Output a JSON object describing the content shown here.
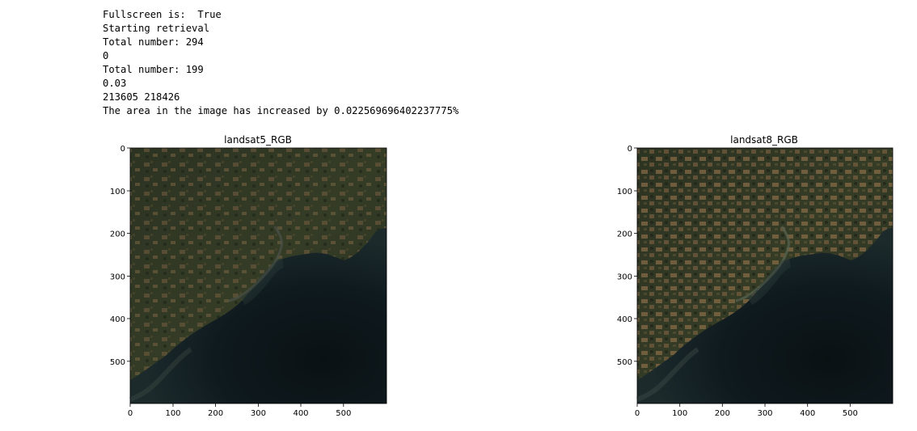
{
  "output": {
    "lines": [
      "Fullscreen is:  True",
      "Starting retrieval",
      "Total number: 294",
      "0",
      "Total number: 199",
      "0.03",
      "213605 218426",
      "The area in the image has increased by 0.022569696402237775%"
    ]
  },
  "plots": [
    {
      "title": "landsat5_RGB",
      "x_ticks": [
        "0",
        "100",
        "200",
        "300",
        "400",
        "500"
      ],
      "y_ticks": [
        "0",
        "100",
        "200",
        "300",
        "400",
        "500"
      ],
      "image": "satellite-coastline-image"
    },
    {
      "title": "landsat8_RGB",
      "x_ticks": [
        "0",
        "100",
        "200",
        "300",
        "400",
        "500"
      ],
      "y_ticks": [
        "0",
        "100",
        "200",
        "300",
        "400",
        "500"
      ],
      "image": "satellite-coastline-image"
    }
  ],
  "colors": {
    "land_dark": "#283020",
    "land_mid": "#3a4428",
    "field_tan": "#6e5a3c",
    "water_deep": "#0c1418",
    "water_shallow": "#2a3a3c"
  }
}
